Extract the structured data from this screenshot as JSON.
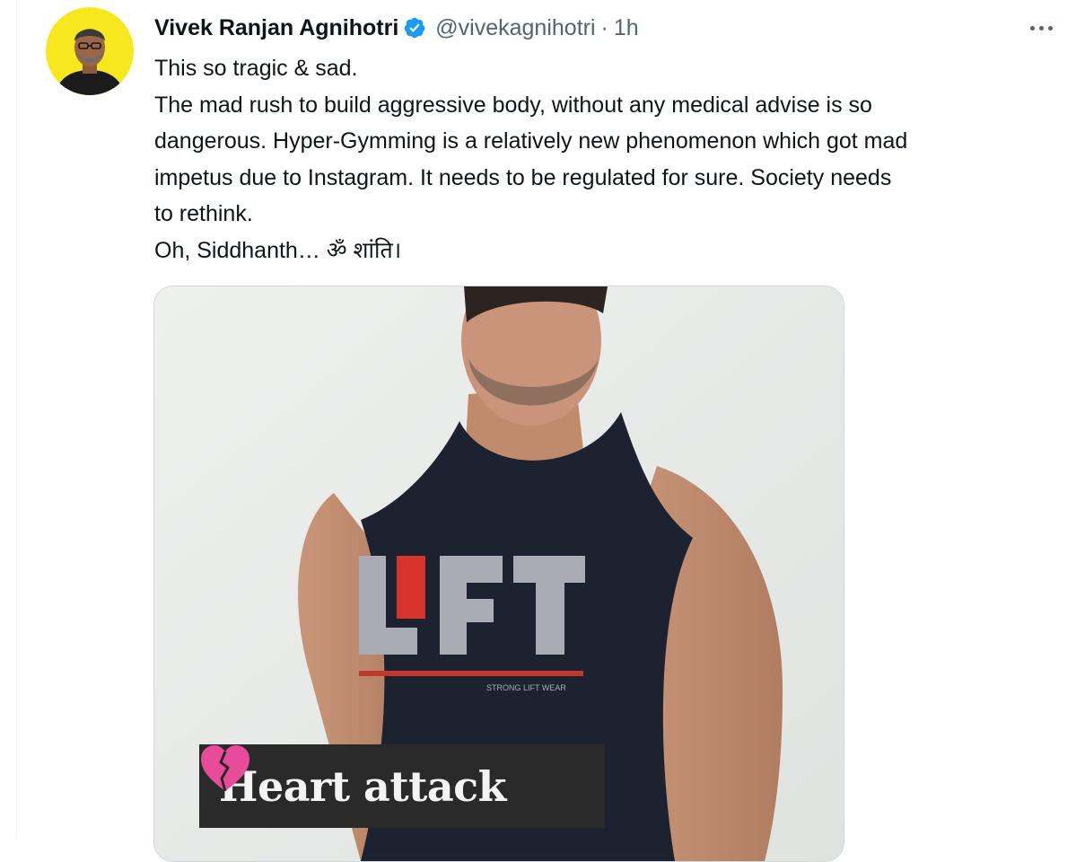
{
  "tweet": {
    "author": {
      "display_name": "Vivek Ranjan Agnihotri",
      "handle": "@vivekagnihotri",
      "verified": true,
      "avatar_bg": "#f6e81c"
    },
    "separator": "·",
    "time": "1h",
    "text_lines": [
      "This so tragic & sad.",
      "The mad rush to build aggressive body, without any medical advise is so",
      "dangerous. Hyper-Gymming is a relatively new phenomenon which got mad",
      "impetus due to Instagram. It needs to be regulated for sure. Society needs",
      "to rethink.",
      "Oh, Siddhanth… ॐ शांति।"
    ],
    "media": {
      "caption": "Heart attack",
      "shirt_text": "LIFT",
      "shirt_small_text": "STRONG LIFT WEAR",
      "caption_icon": "broken-heart-icon"
    }
  },
  "colors": {
    "verified_blue": "#1d9bf0",
    "secondary_text": "#536471"
  }
}
